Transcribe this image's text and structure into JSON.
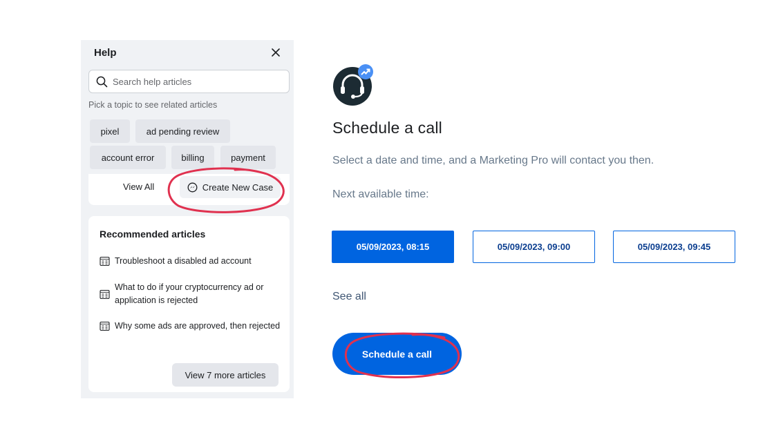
{
  "help": {
    "title": "Help",
    "search_placeholder": "Search help articles",
    "topic_hint": "Pick a topic to see related articles",
    "topics": [
      "pixel",
      "ad pending review",
      "account error",
      "billing",
      "payment"
    ],
    "view_all": "View All",
    "create_case": "Create New Case",
    "recommended": {
      "title": "Recommended articles",
      "articles": [
        "Troubleshoot a disabled ad account",
        "What to do if your cryptocurrency ad or application is rejected",
        "Why some ads are approved, then rejected"
      ],
      "more_button": "View 7 more articles"
    }
  },
  "schedule": {
    "title": "Schedule a call",
    "description": "Select a date and time, and a Marketing Pro will contact you then.",
    "next_label": "Next available time:",
    "times": [
      "05/09/2023, 08:15",
      "05/09/2023, 09:00",
      "05/09/2023, 09:45"
    ],
    "selected_time_index": 0,
    "see_all": "See all",
    "button": "Schedule a call"
  },
  "colors": {
    "accent_blue": "#0064e0",
    "annotation_red": "#e0314f",
    "panel_bg": "#f0f2f5"
  }
}
